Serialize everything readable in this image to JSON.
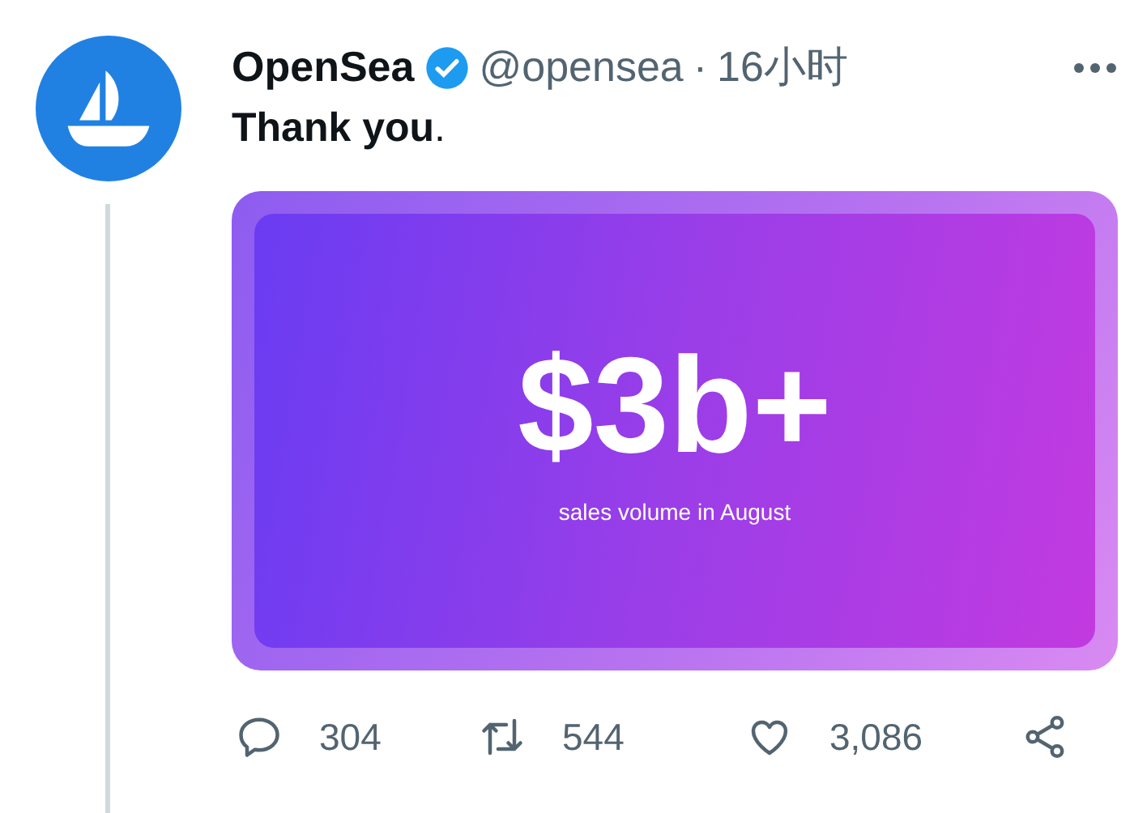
{
  "tweet": {
    "name": "OpenSea",
    "verified": true,
    "handle": "@opensea",
    "separator": "·",
    "time": "16小时",
    "text": "**Thank you**.",
    "media": {
      "headline": "$3b+",
      "caption": "sales volume in August"
    },
    "actions": [
      {
        "kind": "reply",
        "count": "304"
      },
      {
        "kind": "retweet",
        "count": "544"
      },
      {
        "kind": "like",
        "count": "3,086"
      },
      {
        "kind": "share"
      }
    ]
  }
}
